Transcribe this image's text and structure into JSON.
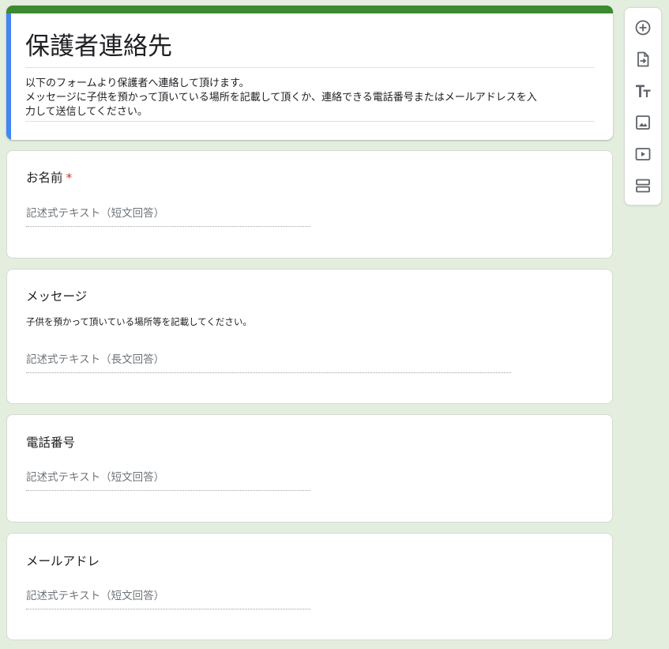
{
  "form": {
    "title": "保護者連絡先",
    "description": [
      "以下のフォームより保護者へ連絡して頂けます。",
      "メッセージに子供を預かって頂いている場所を記載して頂くか、連絡できる電話番号またはメールアドレスを入",
      "力して送信してください。"
    ]
  },
  "questions": [
    {
      "title": "お名前",
      "required_mark": "*",
      "answer_placeholder": "記述式テキスト（短文回答）"
    },
    {
      "title": "メッセージ",
      "description": "子供を預かって頂いている場所等を記載してください。",
      "answer_placeholder": "記述式テキスト（長文回答）"
    },
    {
      "title": "電話番号",
      "answer_placeholder": "記述式テキスト（短文回答）"
    },
    {
      "title": "メールアドレ",
      "answer_placeholder": "記述式テキスト（短文回答）"
    }
  ],
  "toolbar": {
    "icons": [
      "add-question-icon",
      "import-questions-icon",
      "add-title-icon",
      "add-image-icon",
      "add-video-icon",
      "add-section-icon"
    ]
  },
  "colors": {
    "background": "#e3eedf",
    "theme_bar": "#3b8a2f",
    "accent_left": "#4285f4",
    "required": "#d93025",
    "icon": "#5f6368"
  }
}
